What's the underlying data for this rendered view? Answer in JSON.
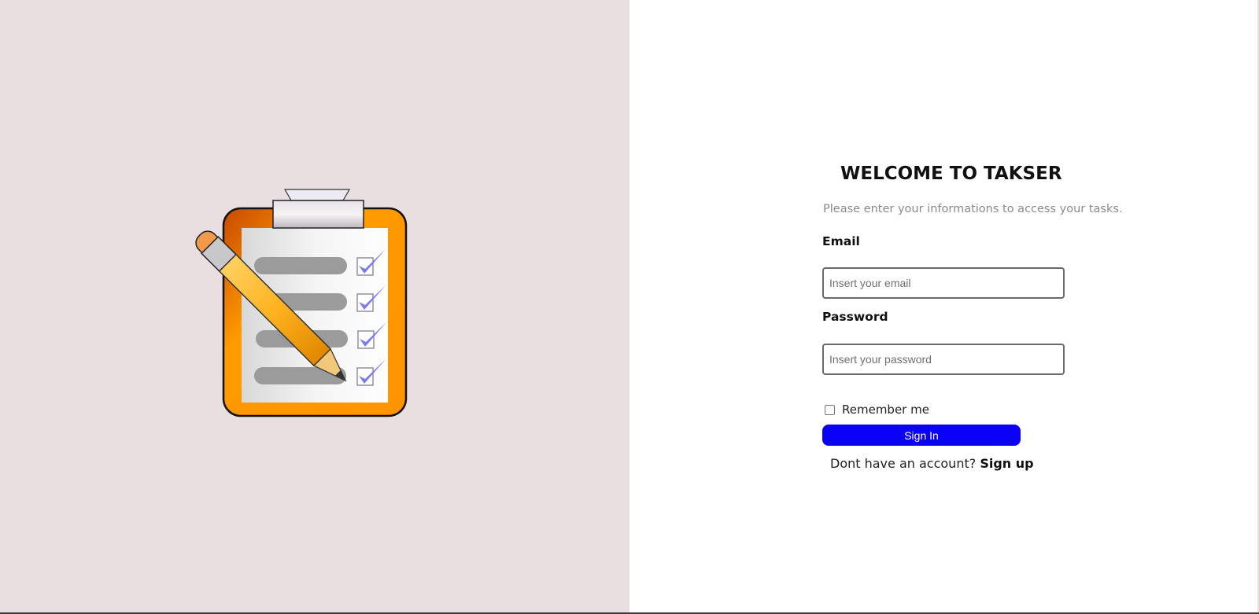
{
  "illustration": {
    "icon": "clipboard-checklist-with-pencil"
  },
  "login": {
    "title": "WELCOME TO TAKSER",
    "subtitle": "Please enter your informations to access your tasks.",
    "email_label": "Email",
    "email_placeholder": "Insert your email",
    "email_value": "",
    "password_label": "Password",
    "password_placeholder": "Insert your password",
    "password_value": "",
    "remember_label": "Remember me",
    "remember_checked": false,
    "signin_label": "Sign In",
    "signup_prompt": "Dont have an account?",
    "signup_link": "Sign up"
  },
  "colors": {
    "left_background": "#e9dfe0",
    "right_background": "#ffffff",
    "signin_button": "#0a00f5",
    "clipboard_orange": "#ff9900",
    "checkmark": "#7b7bf0"
  }
}
